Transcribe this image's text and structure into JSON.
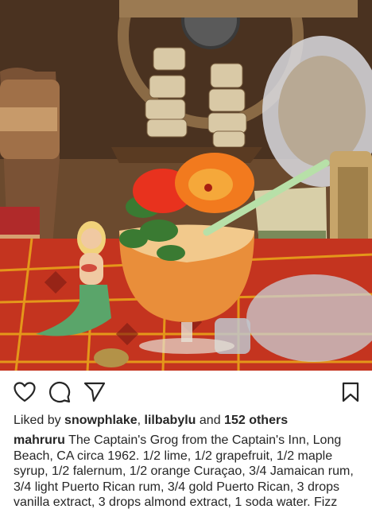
{
  "post": {
    "image_alt_subject": "cocktail-photo",
    "liked_by_prefix": "Liked by",
    "liker_1": "snowphlake",
    "liker_sep": ",",
    "liker_2": "lilbabylu",
    "and_text": "and",
    "others_text": "152 others",
    "author": "mahruru",
    "caption": "The Captain's Grog from the Captain's Inn, Long Beach, CA circa 1962. 1/2 lime, 1/2 grapefruit, 1/2 maple syrup, 1/2 falernum, 1/2 orange Curaçao, 3/4 Jamaican rum, 3/4 light Puerto Rican rum, 3/4 gold Puerto Rican, 3 drops vanilla extract, 3 drops almond extract, 1 soda water. Fizz with crushed ice, dump into double rocks glass..."
  },
  "icons": {
    "like": "heart-icon",
    "comment": "comment-icon",
    "share": "send-icon",
    "save": "bookmark-icon"
  },
  "colors": {
    "text": "#262626",
    "background": "#ffffff"
  }
}
